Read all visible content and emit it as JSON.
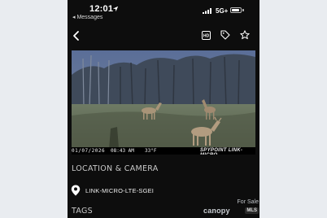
{
  "status_bar": {
    "time": "12:01",
    "back_app": "◂ Messages",
    "network": "5G+"
  },
  "nav": {
    "back_icon": "chevron-left-icon",
    "hd_icon": "hd-badge-icon",
    "tag_icon": "tag-icon",
    "star_icon": "star-icon"
  },
  "photo": {
    "date": "01/07/2026",
    "clock": "08:43 AM",
    "temp": "33°F",
    "brand": "SPYPOINT LINK-MICRO"
  },
  "sections": {
    "location_title": "LOCATION & CAMERA",
    "tags_title": "TAGS"
  },
  "camera": {
    "name": "LINK-MICRO-LTE-SGEI",
    "pin_icon": "map-pin-icon"
  },
  "watermark": {
    "for_sale": "For Sale",
    "brand": "canopy",
    "mls": "MLS"
  }
}
